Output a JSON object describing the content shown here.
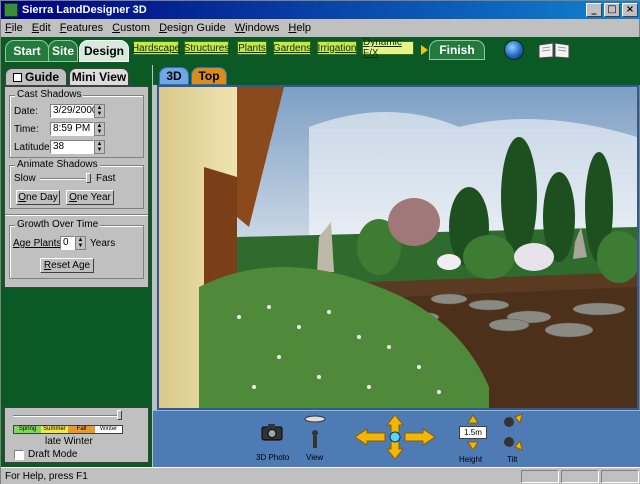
{
  "window": {
    "title": "Sierra LandDesigner 3D"
  },
  "window_controls": {
    "minimize": "_",
    "maximize": "□",
    "close": "×"
  },
  "menu": [
    "File",
    "Edit",
    "Features",
    "Custom",
    "Design Guide",
    "Windows",
    "Help"
  ],
  "nav": {
    "main_tabs": [
      "Start",
      "Site",
      "Design"
    ],
    "active_main": "Design",
    "sub_tabs": [
      "Hardscape",
      "Structures",
      "Plants",
      "Gardens",
      "Irrigation",
      "Dynamic F/X"
    ],
    "active_sub": "Dynamic F/X",
    "finish": "Finish"
  },
  "left_panel": {
    "tabs": [
      "Guide",
      "Mini View"
    ],
    "active_tab": "Mini View",
    "cast_shadows": {
      "title": "Cast Shadows",
      "date_label": "Date:",
      "date_value": "3/29/2000",
      "time_label": "Time:",
      "time_value": "8:59 PM",
      "latitude_label": "Latitude:",
      "latitude_value": "38"
    },
    "animate_shadows": {
      "title": "Animate Shadows",
      "slow": "Slow",
      "fast": "Fast",
      "one_day": "One Day",
      "one_year": "One Year"
    },
    "growth": {
      "title": "Growth Over Time",
      "age_label": "Age Plants:",
      "age_value": "0",
      "years": "Years",
      "reset": "Reset Age"
    },
    "season": {
      "seasons": [
        "Spring",
        "Summer",
        "Fall",
        "Winter"
      ],
      "season_colors": [
        "#7ed957",
        "#f2e64a",
        "#e59a2b",
        "#ffffff"
      ],
      "current": "late Winter"
    },
    "draft_mode": "Draft Mode"
  },
  "view_tabs": [
    "3D",
    "Top"
  ],
  "active_view": "3D",
  "toolbar": {
    "photo_label": "3D Photo",
    "view_label": "View",
    "height_value": "1.5m",
    "height_label": "Height",
    "tilt_label": "Tilt"
  },
  "status": {
    "text": "For Help, press F1"
  }
}
